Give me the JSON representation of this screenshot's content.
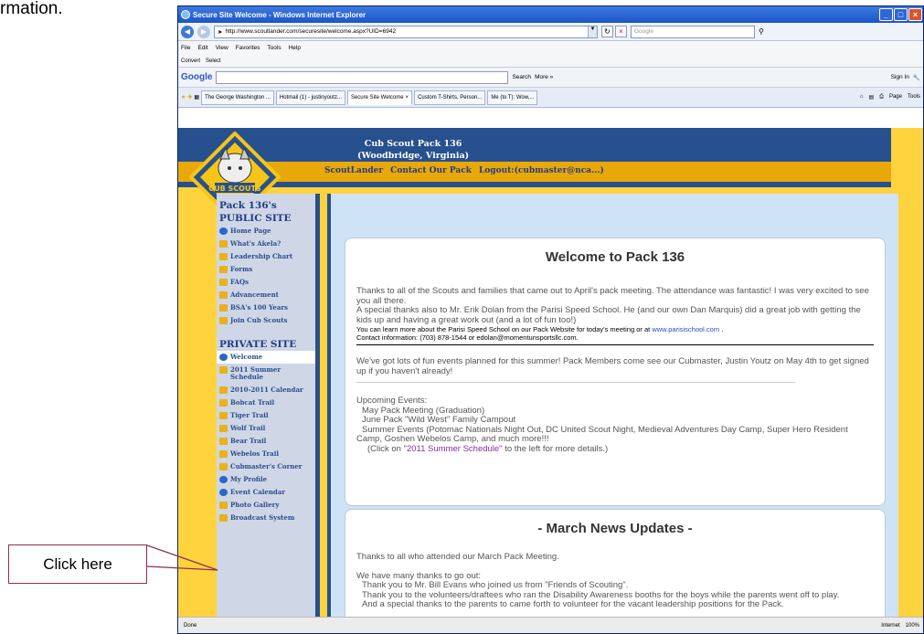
{
  "doc_fragment": "rmation.",
  "browser": {
    "title": "Secure Site Welcome - Windows Internet Explorer",
    "url": "http://www.scoutlander.com/securesite/welcome.aspx?UID=6942",
    "search_placeholder": "Google",
    "menu": [
      "File",
      "Edit",
      "View",
      "Favorites",
      "Tools",
      "Help"
    ],
    "commands": [
      "Convert",
      "Select"
    ],
    "google_bar": {
      "logo": "Google",
      "search": "Search",
      "more": "More »",
      "sign_in": "Sign In"
    },
    "tabs": [
      {
        "label": "The George Washington ...",
        "active": false
      },
      {
        "label": "Hotmail (1) - justinyoutz...",
        "active": false
      },
      {
        "label": "Secure Site Welcome",
        "active": true
      },
      {
        "label": "Custom T-Shirts, Person...",
        "active": false
      },
      {
        "label": "Me (to T): Wow,...",
        "active": false
      }
    ],
    "tab_tools": [
      "Page",
      "Tools"
    ]
  },
  "site": {
    "header_line1": "Cub Scout Pack 136",
    "header_line2": "(Woodbridge, Virginia)",
    "nav": [
      "ScoutLander",
      "Contact Our Pack",
      "Logout:(cubmaster@nca...)"
    ],
    "logo_text": "CUB SCOUTS"
  },
  "sidebar": {
    "public_heading_1": "Pack 136's",
    "public_heading_2": "PUBLIC SITE",
    "public_items": [
      "Home Page",
      "What's Akela?",
      "Leadership Chart",
      "Forms",
      "FAQs",
      "Advancement",
      "BSA's 100 Years",
      "Join Cub Scouts"
    ],
    "private_heading": "PRIVATE SITE",
    "private_items": [
      "Welcome",
      "2011 Summer Schedule",
      "2010-2011 Calendar",
      "Bobcat Trail",
      "Tiger Trail",
      "Wolf Trail",
      "Bear Trail",
      "Webelos Trail",
      "Cubmaster's Corner",
      "My Profile",
      "Event Calendar",
      "Photo Gallery",
      "Broadcast System"
    ]
  },
  "welcome": {
    "title": "Welcome to Pack 136",
    "p1": "Thanks to all of the Scouts and families that came out to April's pack meeting.  The attendance was fantastic! I was very excited to see you all there.",
    "p2": "A special thanks also to Mr. Erik Dolan from the Parisi Speed School. He (and our own Dan Marquis) did a great job with getting the kids up and having a great work out (and a lot of fun too!)",
    "p3a": "You can learn more about the Parisi Speed School on our Pack Website for today's meeting or at",
    "p3link": "www.parisischool.com",
    "p3b": ".",
    "p4": "Contact information:  (703) 878-1544 or edolan@momentunsportsllc.com.",
    "p5": "We've got lots of fun events planned for this summer! Pack Members come see our Cubmaster, Justin Youtz on May 4th to get signed up if you haven't already!",
    "events_heading": "Upcoming Events:",
    "events": [
      "May Pack Meeting (Graduation)",
      "June Pack \"Wild West\" Family Campout",
      "Summer Events (Potomac Nationals Night Out, DC United Scout Night, Medieval Adventures Day Camp, Super Hero Resident Camp, Goshen Webelos Camp, and much more!!!"
    ],
    "click_a": "(Click on",
    "click_link": "\"2011 Summer Schedule\"",
    "click_b": "to the left for more details.)"
  },
  "march": {
    "title": "- March News Updates -",
    "p1": "Thanks to all who attended our March Pack Meeting.",
    "p2": "We have many thanks to go out:",
    "p3": "Thank you to Mr. Bill Evans who joined us from \"Friends of Scouting\".",
    "p4": "Thank you to the volunteers/draftees who ran the Disability Awareness booths for the boys while the parents went off to play.",
    "p5": "And a special thanks to the parents to came forth to volunteer for the vacant leadership positions for the Pack."
  },
  "callout": {
    "label": "Click here"
  },
  "status": {
    "done": "Done",
    "zone": "Internet",
    "zoom": "100%"
  },
  "colors": {
    "accent": "#27508f",
    "page_bg": "#ffd33d",
    "gold": "#e9a80a"
  }
}
